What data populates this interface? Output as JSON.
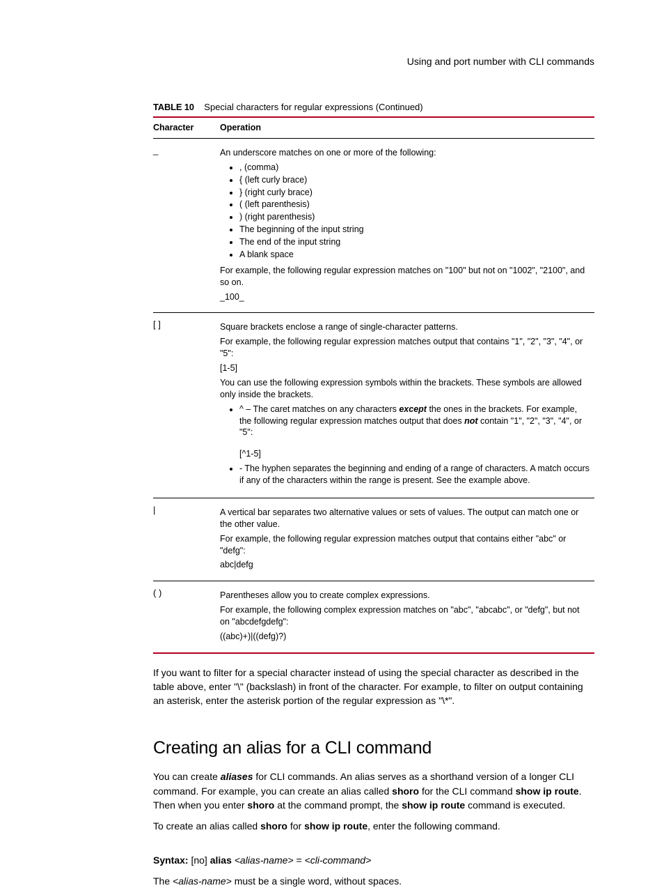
{
  "running_header": "Using and port number with CLI commands",
  "table": {
    "label": "TABLE 10",
    "title": "Special characters for regular expressions  (Continued)",
    "head": {
      "c1": "Character",
      "c2": "Operation"
    },
    "rows": [
      {
        "char": "_",
        "lead": "An underscore matches on one or more of the following:",
        "bullets": [
          ", (comma)",
          "{ (left curly brace)",
          "} (right curly brace)",
          "( (left parenthesis)",
          ") (right parenthesis)",
          "The beginning of the input string",
          "The end of the input string",
          "A blank space"
        ],
        "tail1": "For example, the following regular expression matches on \"100\" but not on \"1002\", \"2100\", and so on.",
        "tail2": "_100_"
      },
      {
        "char": "[ ]",
        "l1": "Square brackets enclose a range of single-character patterns.",
        "l2": "For example, the following regular expression matches output that contains \"1\", \"2\", \"3\", \"4\", or \"5\":",
        "l3": "[1-5]",
        "l4": "You can use the following expression symbols within the brackets.  These symbols are allowed only inside the brackets.",
        "b1a": "^ – The caret matches on any characters ",
        "b1b_bi": "except",
        "b1c": " the ones in the brackets.  For example, the following regular expression matches output that does ",
        "b1d_bi": "not",
        "b1e": " contain \"1\", \"2\", \"3\", \"4\", or \"5\":",
        "b1ex": "[^1-5]",
        "b2": "- The hyphen separates the beginning and ending of a range of characters.  A match occurs if any of the characters within the range is present.  See the example above."
      },
      {
        "char": "|",
        "l1": "A vertical bar separates two alternative values or sets of values.  The output can match one or the other value.",
        "l2": "For example, the following regular expression matches output that contains either \"abc\" or \"defg\":",
        "l3": "abc|defg"
      },
      {
        "char": "( )",
        "l1": "Parentheses allow you to create complex expressions.",
        "l2": "For example, the following complex expression matches on \"abc\", \"abcabc\", or \"defg\", but not on \"abcdefgdefg\":",
        "l3": "((abc)+)|((defg)?)"
      }
    ]
  },
  "after_table_para": "If you want to filter for a special character instead of using the special character as described in the table above, enter \"\\\" (backslash) in front of the character.  For example, to filter on output containing an asterisk, enter the asterisk portion of the regular expression as \"\\*\".",
  "h2": "Creating an alias for a CLI command",
  "p1": {
    "a": "You can create ",
    "b_bi": "aliases",
    "c": " for CLI commands.  An alias serves as a shorthand version of a longer CLI command.  For example, you can create an alias called ",
    "d_b": "shoro",
    "e": " for the CLI command ",
    "f_b": "show ip route",
    "g": ". Then when you enter ",
    "h_b": "shoro",
    "i_": " at the command prompt, the ",
    "j_b": "show ip route",
    "k": " command is executed."
  },
  "p2": {
    "a": "To create an alias called ",
    "b_b": "shoro",
    "c": " for ",
    "d_b": "show ip route",
    "e": ", enter the following command."
  },
  "syntax": {
    "label": "Syntax:",
    "a": "  [no] ",
    "b_b": "alias",
    "c": " ",
    "d_i": "<alias-name>",
    "e": " = ",
    "f_i": "<cli-command>"
  },
  "p3": {
    "a": "The ",
    "b_i": "<alias-name>",
    "c": " must be a single word, without spaces."
  }
}
